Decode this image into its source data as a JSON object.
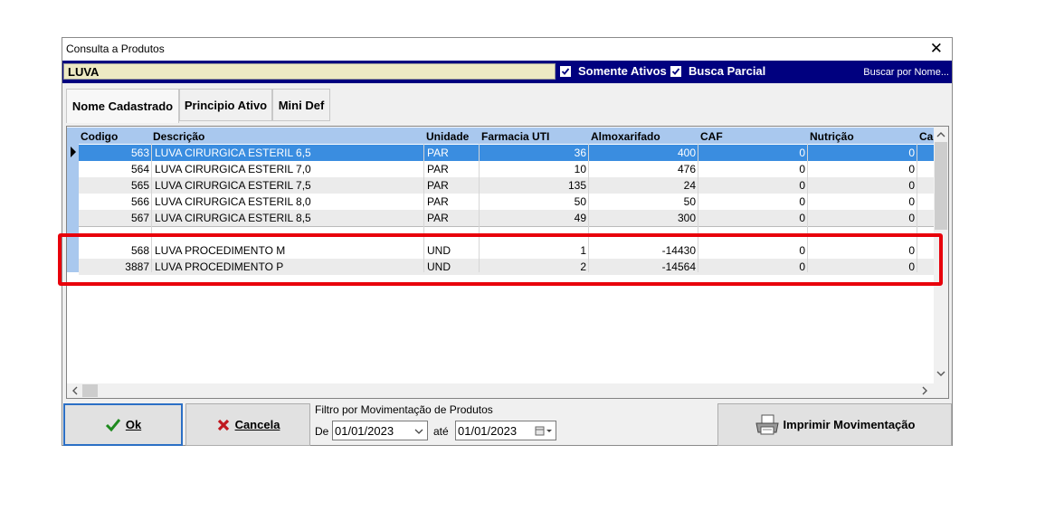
{
  "window": {
    "title": "Consulta a Produtos",
    "close_glyph": "✕"
  },
  "search": {
    "value": "LUVA",
    "somente_ativos_label": "Somente Ativos",
    "somente_ativos_checked": true,
    "busca_parcial_label": "Busca Parcial",
    "busca_parcial_checked": true,
    "buscar_por_label": "Buscar por Nome..."
  },
  "tabs": [
    {
      "label": "Nome Cadastrado",
      "active": true
    },
    {
      "label": "Principio Ativo",
      "active": false
    },
    {
      "label": "Mini Def",
      "active": false
    }
  ],
  "grid": {
    "columns": [
      "Codigo",
      "Descrição",
      "Unidade",
      "Farmacia UTI",
      "Almoxarifado",
      "CAF",
      "Nutrição",
      "Ca"
    ],
    "rows": [
      {
        "codigo": "563",
        "descricao": "LUVA CIRURGICA ESTERIL 6,5",
        "unidade": "PAR",
        "farmacia_uti": "36",
        "almoxarifado": "400",
        "caf": "0",
        "nutricao": "0"
      },
      {
        "codigo": "564",
        "descricao": "LUVA CIRURGICA ESTERIL 7,0",
        "unidade": "PAR",
        "farmacia_uti": "10",
        "almoxarifado": "476",
        "caf": "0",
        "nutricao": "0"
      },
      {
        "codigo": "565",
        "descricao": "LUVA CIRURGICA ESTERIL 7,5",
        "unidade": "PAR",
        "farmacia_uti": "135",
        "almoxarifado": "24",
        "caf": "0",
        "nutricao": "0"
      },
      {
        "codigo": "566",
        "descricao": "LUVA CIRURGICA ESTERIL 8,0",
        "unidade": "PAR",
        "farmacia_uti": "50",
        "almoxarifado": "50",
        "caf": "0",
        "nutricao": "0"
      },
      {
        "codigo": "567",
        "descricao": "LUVA CIRURGICA ESTERIL 8,5",
        "unidade": "PAR",
        "farmacia_uti": "49",
        "almoxarifado": "300",
        "caf": "0",
        "nutricao": "0"
      },
      {
        "codigo": "568",
        "descricao": "LUVA PROCEDIMENTO M",
        "unidade": "UND",
        "farmacia_uti": "1",
        "almoxarifado": "-14430",
        "caf": "0",
        "nutricao": "0"
      },
      {
        "codigo": "3887",
        "descricao": "LUVA PROCEDIMENTO P",
        "unidade": "UND",
        "farmacia_uti": "2",
        "almoxarifado": "-14564",
        "caf": "0",
        "nutricao": "0"
      }
    ],
    "selected_row": 0
  },
  "buttons": {
    "ok_label": "Ok",
    "cancela_label": "Cancela",
    "imprimir_label": "Imprimir Movimentação"
  },
  "filter": {
    "title": "Filtro por Movimentação de Produtos",
    "de_label": "De",
    "de_value": "01/01/2023",
    "ate_label": "até",
    "ate_value": "01/01/2023"
  },
  "colors": {
    "title_bar_blue": "#00007f",
    "search_field_bg": "#ede9c3",
    "header_blue": "#a9c8ee",
    "selected_row": "#3a8de0",
    "highlight_red": "#e8000b",
    "ok_check_green": "#1e8a1e",
    "cancel_x_red": "#c0181f"
  },
  "icons": [
    "close-icon",
    "checkbox-checked-icon",
    "check-icon",
    "x-icon",
    "printer-icon",
    "chevron-down-icon",
    "calendar-icon",
    "row-pointer-icon",
    "scroll-up-icon",
    "scroll-down-icon",
    "scroll-left-icon",
    "scroll-right-icon"
  ]
}
